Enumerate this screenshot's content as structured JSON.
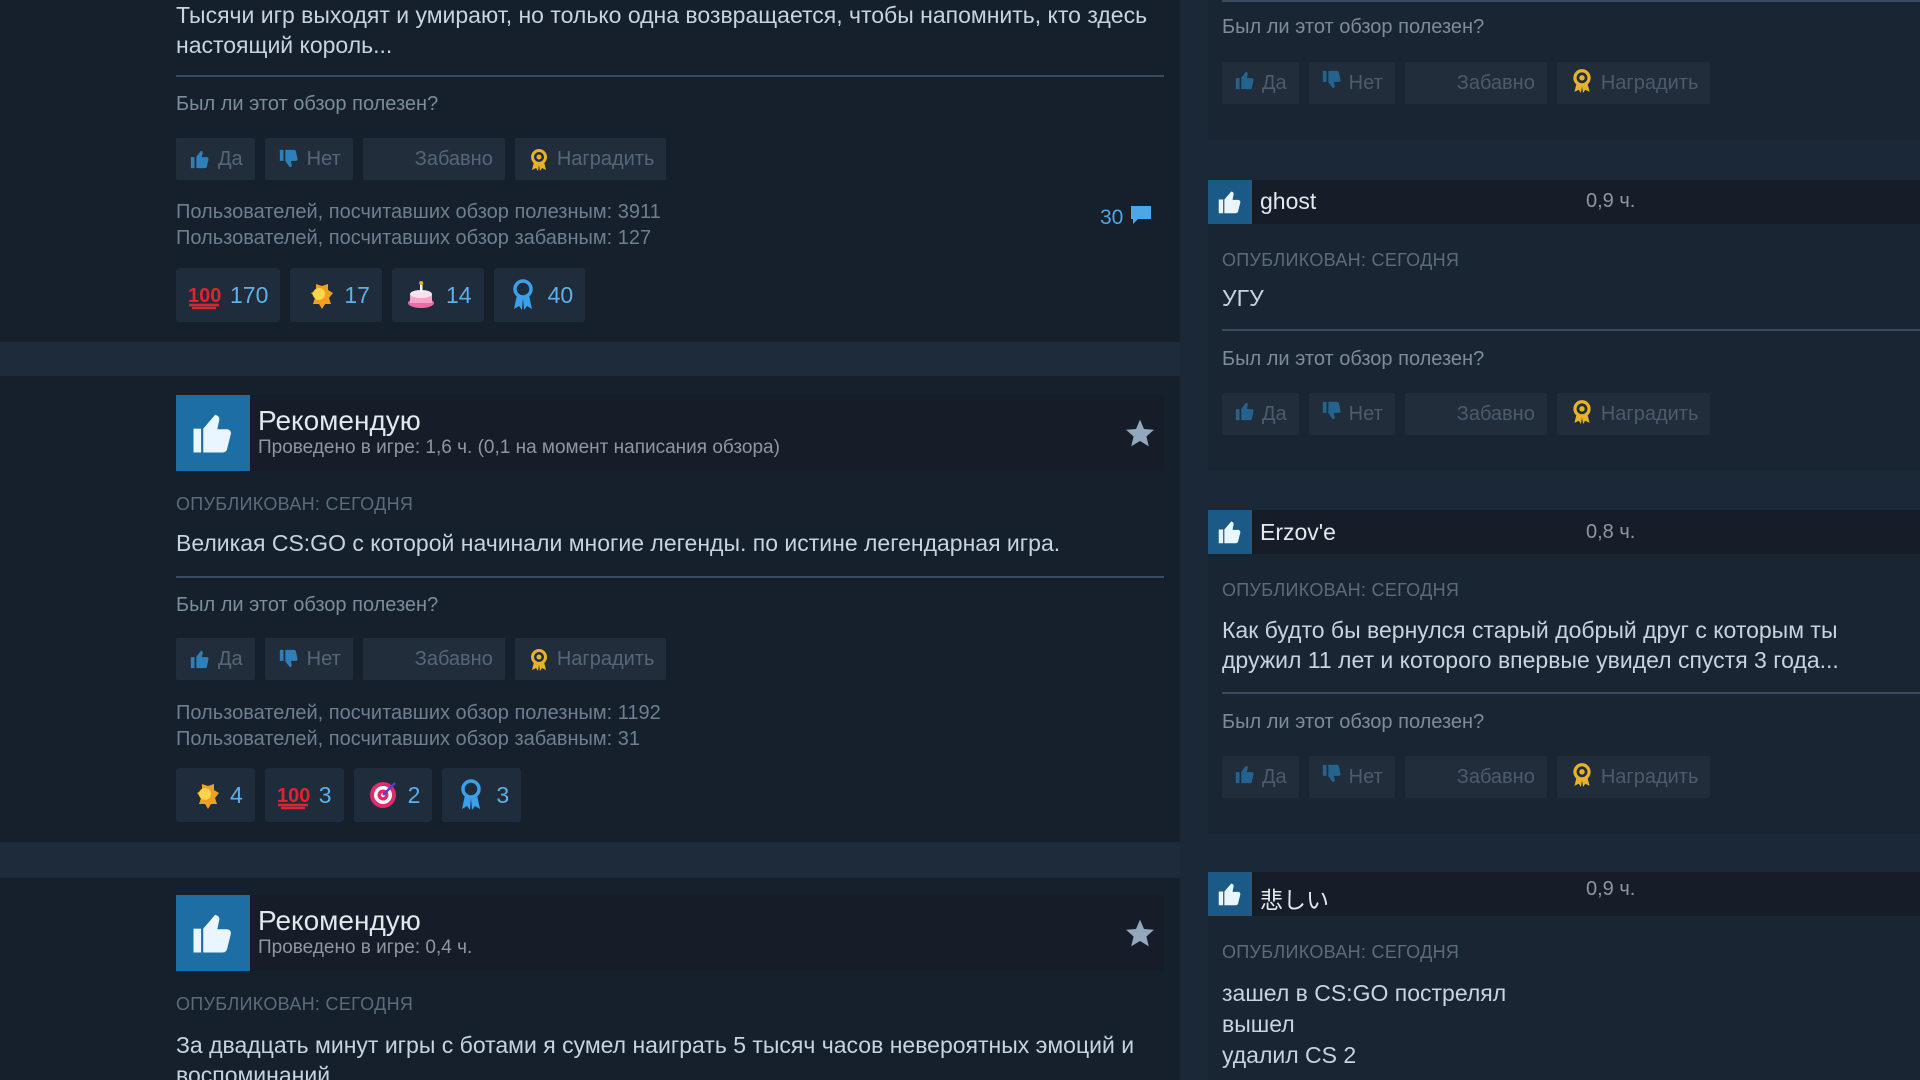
{
  "left": {
    "fragment": "s",
    "review1": {
      "text": "Тысячи игр выходят и умирают, но только одна возвращается, чтобы напомнить, кто здесь настоящий король...",
      "helpful_question": "Был ли этот обзор полезен?",
      "buttons": {
        "yes": "Да",
        "no": "Нет",
        "funny": "Забавно",
        "award": "Наградить"
      },
      "helpful_count": "Пользователей, посчитавших обзор полезным: 3911",
      "funny_count": "Пользователей, посчитавших обзор забавным: 127",
      "comments": "30",
      "awards": [
        {
          "icon": "hundred-icon",
          "count": "170"
        },
        {
          "icon": "medal-burst-icon",
          "count": "17"
        },
        {
          "icon": "cake-icon",
          "count": "14"
        },
        {
          "icon": "ribbon-icon",
          "count": "40"
        }
      ]
    },
    "review2": {
      "title": "Рекомендую",
      "hours": "Проведено в игре: 1,6 ч. (0,1 на момент написания обзора)",
      "posted": "ОПУБЛИКОВАН: СЕГОДНЯ",
      "text": "Великая CS:GO с которой начинали многие легенды. по истине легендарная игра.",
      "helpful_question": "Был ли этот обзор полезен?",
      "buttons": {
        "yes": "Да",
        "no": "Нет",
        "funny": "Забавно",
        "award": "Наградить"
      },
      "helpful_count": "Пользователей, посчитавших обзор полезным: 1192",
      "funny_count": "Пользователей, посчитавших обзор забавным: 31",
      "awards": [
        {
          "icon": "medal-burst-icon",
          "count": "4"
        },
        {
          "icon": "hundred-icon",
          "count": "3"
        },
        {
          "icon": "target-icon",
          "count": "2"
        },
        {
          "icon": "ribbon-icon",
          "count": "3"
        }
      ]
    },
    "review3": {
      "title": "Рекомендую",
      "hours": "Проведено в игре: 0,4 ч.",
      "posted": "ОПУБЛИКОВАН: СЕГОДНЯ",
      "text": "За двадцать минут игры с ботами я сумел наиграть 5 тысяч часов невероятных эмоций и воспоминаний"
    }
  },
  "right": {
    "top": {
      "helpful_question": "Был ли этот обзор полезен?",
      "buttons": {
        "yes": "Да",
        "no": "Нет",
        "funny": "Забавно",
        "award": "Наградить"
      }
    },
    "review_ghost": {
      "name": "ghost",
      "hours": "0,9 ч.",
      "posted": "ОПУБЛИКОВАН: СЕГОДНЯ",
      "text": "УГУ",
      "helpful_question": "Был ли этот обзор полезен?",
      "buttons": {
        "yes": "Да",
        "no": "Нет",
        "funny": "Забавно",
        "award": "Наградить"
      }
    },
    "review_erzov": {
      "name": "Erzov'e",
      "hours": "0,8 ч.",
      "posted": "ОПУБЛИКОВАН: СЕГОДНЯ",
      "text_line1": "Как будто бы вернулся старый добрый друг с которым ты",
      "text_line2": "дружил 11 лет и которого впервые увидел спустя 3 года...",
      "helpful_question": "Был ли этот обзор полезен?",
      "buttons": {
        "yes": "Да",
        "no": "Нет",
        "funny": "Забавно",
        "award": "Наградить"
      }
    },
    "review_kanashii": {
      "name": "悲しい",
      "hours": "0,9 ч.",
      "posted": "ОПУБЛИКОВАН: СЕГОДНЯ",
      "line1": "зашел в CS:GO пострелял",
      "line2": "вышел",
      "line3": "удалил CS 2"
    }
  },
  "colors": {
    "background": "#1b2838",
    "card": "#16202d",
    "accent": "#1c6ea3",
    "link": "#4ea6e6"
  }
}
